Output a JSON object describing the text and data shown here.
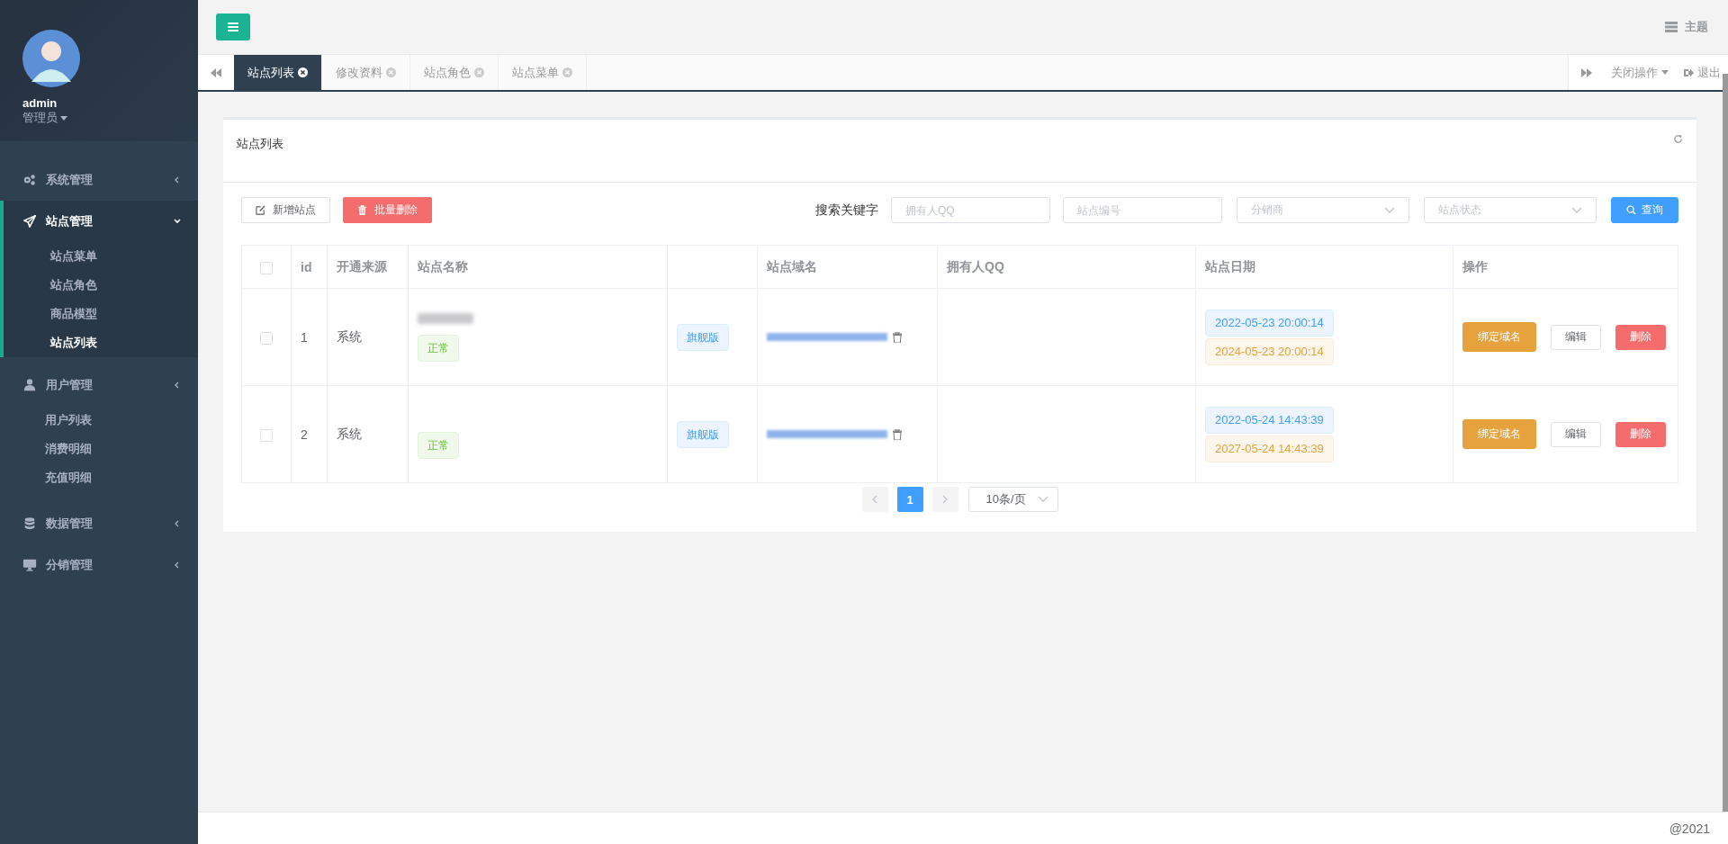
{
  "user": {
    "name": "admin",
    "role": "管理员"
  },
  "sidebar": {
    "items": [
      {
        "label": "系统管理",
        "active": false
      },
      {
        "label": "站点管理",
        "active": true,
        "children": [
          {
            "label": "站点菜单",
            "selected": false
          },
          {
            "label": "站点角色",
            "selected": false
          },
          {
            "label": "商品模型",
            "selected": false
          },
          {
            "label": "站点列表",
            "selected": true
          }
        ]
      },
      {
        "label": "用户管理",
        "active": false,
        "children": [
          {
            "label": "用户列表",
            "selected": false
          },
          {
            "label": "消费明细",
            "selected": false
          },
          {
            "label": "充值明细",
            "selected": false
          }
        ]
      },
      {
        "label": "数据管理",
        "active": false
      },
      {
        "label": "分销管理",
        "active": false
      }
    ]
  },
  "header": {
    "theme": "主题"
  },
  "tabs": [
    {
      "label": "站点列表",
      "selected": true
    },
    {
      "label": "修改资料",
      "selected": false
    },
    {
      "label": "站点角色",
      "selected": false
    },
    {
      "label": "站点菜单",
      "selected": false
    }
  ],
  "tab_actions": {
    "close": "关闭操作",
    "logout": "退出"
  },
  "card": {
    "title": "站点列表"
  },
  "toolbar": {
    "buttons": [
      {
        "label": "新增站点",
        "kind": "add"
      },
      {
        "label": "批量删除",
        "kind": "delete"
      }
    ],
    "search_label": "搜索关键字",
    "fields": [
      {
        "placeholder": "拥有人QQ",
        "kind": "input"
      },
      {
        "placeholder": "站点编号",
        "kind": "input"
      },
      {
        "placeholder": "分销商",
        "kind": "select"
      },
      {
        "placeholder": "站点状态",
        "kind": "select"
      }
    ],
    "search_button": "查询"
  },
  "table": {
    "columns": [
      {
        "kind": "checkbox",
        "checked": false
      },
      {
        "kind": "text",
        "label": "id"
      },
      {
        "kind": "text",
        "label": "开通来源"
      },
      {
        "kind": "text",
        "label": "站点名称"
      },
      {
        "kind": "blank"
      },
      {
        "kind": "text",
        "label": "站点域名"
      },
      {
        "kind": "text",
        "label": "拥有人QQ"
      },
      {
        "kind": "text",
        "label": "站点日期"
      },
      {
        "kind": "text",
        "label": "操作"
      }
    ],
    "rows": [
      {
        "checked": false,
        "id": "1",
        "source": "系统",
        "name_blurred": true,
        "status": "正常",
        "edition": "旗舰版",
        "start": "2022-05-23 20:00:14",
        "end": "2024-05-23 20:00:14",
        "actions": [
          {
            "label": "绑定域名",
            "kind": "bind"
          },
          {
            "label": "编辑",
            "kind": "edit"
          },
          {
            "label": "删除",
            "kind": "delete"
          }
        ]
      },
      {
        "checked": false,
        "id": "2",
        "source": "系统",
        "name_blurred": false,
        "status": "正常",
        "edition": "旗舰版",
        "start": "2022-05-24 14:43:39",
        "end": "2027-05-24 14:43:39",
        "actions": [
          {
            "label": "绑定域名",
            "kind": "bind"
          },
          {
            "label": "编辑",
            "kind": "edit"
          },
          {
            "label": "删除",
            "kind": "delete"
          }
        ]
      }
    ]
  },
  "pagination": {
    "pages": [
      {
        "label": "1",
        "selected": true
      }
    ],
    "page_size": "10条/页"
  },
  "footer": "@2021"
}
